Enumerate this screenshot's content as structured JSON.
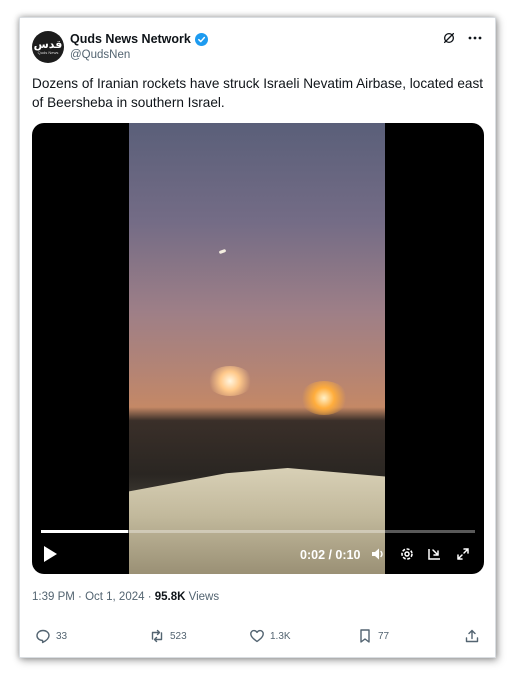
{
  "author": {
    "display_name": "Quds News Network",
    "handle": "@QudsNen",
    "avatar_glyph": "قدس",
    "avatar_sub": "Quds News"
  },
  "top_icons": [
    "grok-icon",
    "more-icon"
  ],
  "tweet": {
    "text": "Dozens of Iranian rockets have struck Israeli Nevatim Airbase, located east of Beersheba in southern Israel."
  },
  "video": {
    "time": "0:02 / 0:10",
    "progress_fraction": 0.2,
    "controls": [
      "play-icon",
      "volume-icon",
      "settings-icon",
      "pip-icon",
      "fullscreen-icon"
    ]
  },
  "meta": {
    "time": "1:39 PM",
    "separator1": " · ",
    "date": "Oct 1, 2024",
    "separator2": " · ",
    "views_count": "95.8K",
    "views_label": " Views"
  },
  "actions": {
    "replies": "33",
    "reposts": "523",
    "likes": "1.3K",
    "bookmarks": "77"
  },
  "colors": {
    "accent": "#1d9bf0",
    "text_primary": "#0f1419",
    "text_secondary": "#536471"
  }
}
